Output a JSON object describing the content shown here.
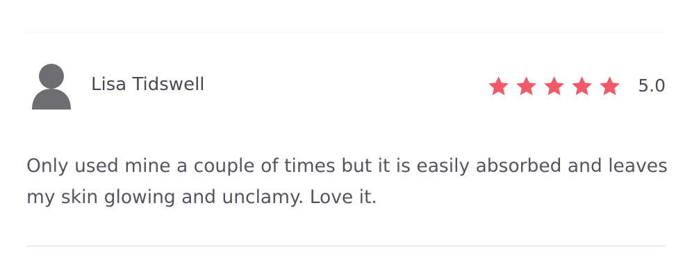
{
  "review": {
    "reviewer_name": "Lisa Tidswell",
    "rating": 5,
    "rating_max": 5,
    "rating_label": "5.0",
    "body": "Only used mine a couple of times but it is easily absorbed and leaves my skin glowing and unclamy. Love it."
  },
  "icons": {
    "avatar": "user-silhouette-icon",
    "star": "star-icon"
  },
  "colors": {
    "star": "#f25a67",
    "avatar": "#6e6e72",
    "text": "#4a4a55",
    "divider": "#ececec"
  }
}
